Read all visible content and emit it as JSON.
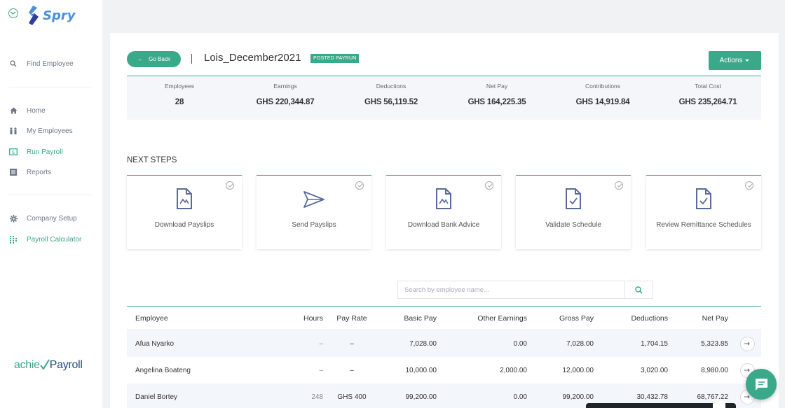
{
  "app": {
    "name": "Spry",
    "footer_brand_part1": "achie",
    "footer_brand_part2": "Payroll"
  },
  "sidebar": {
    "find_employee": {
      "label": "Find Employee",
      "icon": "search-icon"
    },
    "items": [
      {
        "label": "Home",
        "icon": "home-icon"
      },
      {
        "label": "My Employees",
        "icon": "people-icon"
      },
      {
        "label": "Run Payroll",
        "icon": "payroll-icon",
        "active": true
      },
      {
        "label": "Reports",
        "icon": "reports-icon"
      }
    ],
    "settings": [
      {
        "label": "Company Setup",
        "icon": "gear-icon"
      },
      {
        "label": "Payroll Calculator",
        "icon": "calculator-icon"
      }
    ]
  },
  "header": {
    "go_back_label": "Go Back",
    "go_back_arrow": "←",
    "payrun_title": "Lois_December2021",
    "status_badge": "POSTED PAYRUN",
    "actions_label": "Actions"
  },
  "summary": [
    {
      "label": "Employees",
      "value": "28"
    },
    {
      "label": "Earnings",
      "value": "GHS 220,344.87"
    },
    {
      "label": "Deductions",
      "value": "GHS 56,119.52"
    },
    {
      "label": "Net Pay",
      "value": "GHS 164,225.35"
    },
    {
      "label": "Contributions",
      "value": "GHS 14,919.84"
    },
    {
      "label": "Total Cost",
      "value": "GHS 235,264.71"
    }
  ],
  "next_steps": {
    "heading": "NEXT STEPS",
    "cards": [
      {
        "label": "Download Payslips",
        "icon": "payslip-document-icon"
      },
      {
        "label": "Send Payslips",
        "icon": "send-icon"
      },
      {
        "label": "Download Bank Advice",
        "icon": "bank-advice-document-icon"
      },
      {
        "label": "Validate Schedule",
        "icon": "validate-document-icon"
      },
      {
        "label": "Review Remittance Schedules",
        "icon": "remittance-document-icon"
      }
    ]
  },
  "search": {
    "placeholder": "Search by employee name..."
  },
  "table": {
    "headers": {
      "employee": "Employee",
      "hours": "Hours",
      "pay_rate": "Pay Rate",
      "basic_pay": "Basic Pay",
      "other_earnings": "Other Earnings",
      "gross_pay": "Gross Pay",
      "deductions": "Deductions",
      "net_pay": "Net Pay"
    },
    "rows": [
      {
        "employee": "Afua Nyarko",
        "hours": "–",
        "pay_rate": "–",
        "basic_pay": "7,028.00",
        "other_earnings": "0.00",
        "gross_pay": "7,028.00",
        "deductions": "1,704.15",
        "net_pay": "5,323.85"
      },
      {
        "employee": "Angelina Boateng",
        "hours": "–",
        "pay_rate": "–",
        "basic_pay": "10,000.00",
        "other_earnings": "2,000.00",
        "gross_pay": "12,000.00",
        "deductions": "3,020.00",
        "net_pay": "8,980.00"
      },
      {
        "employee": "Daniel Bortey",
        "hours": "248",
        "pay_rate": "GHS 400",
        "basic_pay": "99,200.00",
        "other_earnings": "0.00",
        "gross_pay": "99,200.00",
        "deductions": "30,432.78",
        "net_pay": "68,767.22"
      }
    ]
  },
  "colors": {
    "accent": "#3aa98a",
    "summary_bg": "#f4f6fa",
    "page_bg": "#f1f2f4"
  }
}
